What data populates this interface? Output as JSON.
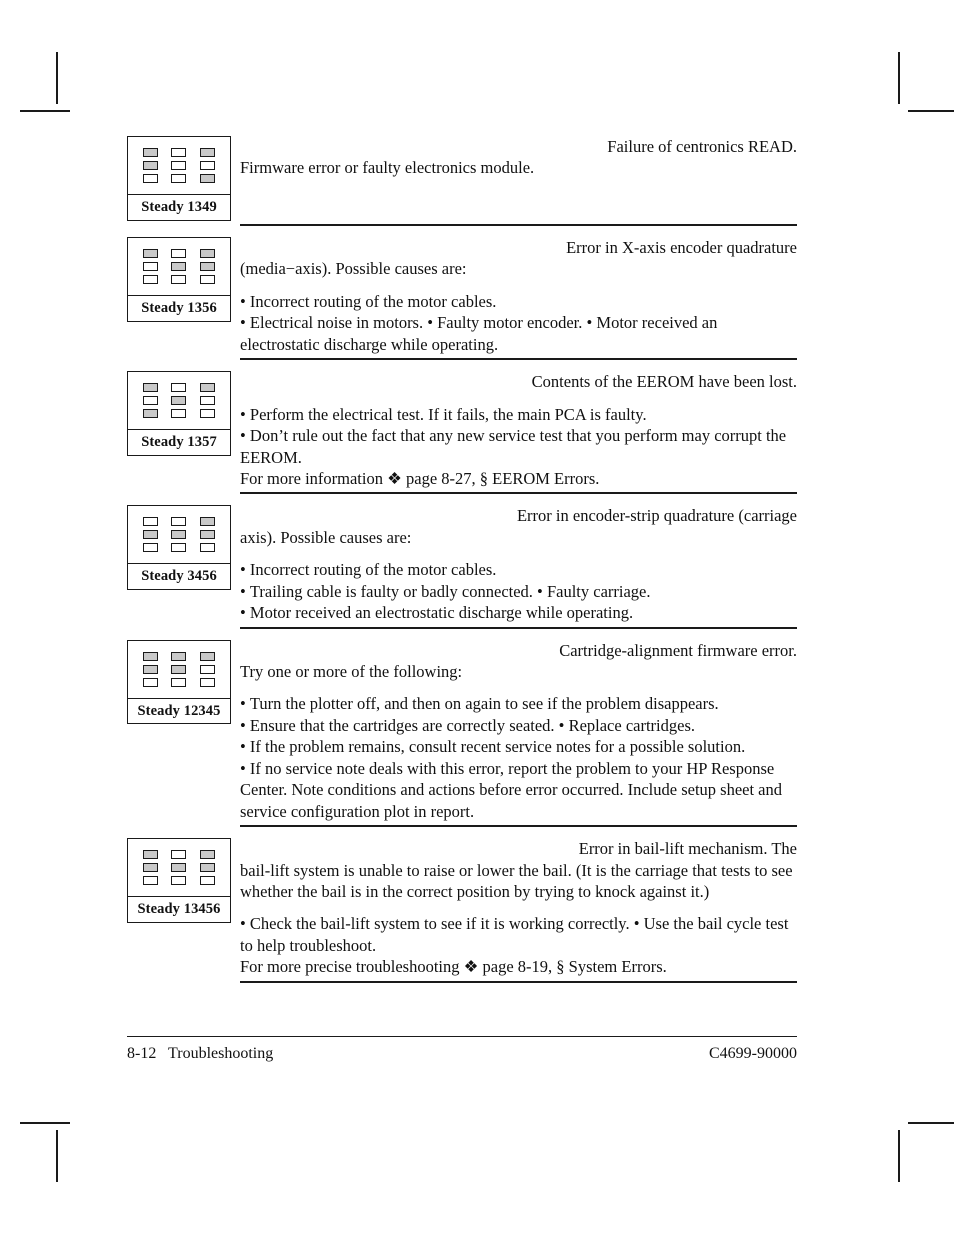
{
  "page": {
    "footer_left": "8-12   Troubleshooting",
    "footer_right": "C4699-90000"
  },
  "entries": [
    {
      "code_label": "Steady 1349",
      "leds": [
        [
          1,
          0,
          1
        ],
        [
          1,
          0,
          0
        ],
        [
          0,
          0,
          1
        ]
      ],
      "title": "Failure of centronics READ.",
      "lead": "Firmware error or faulty electronics module.",
      "lines": []
    },
    {
      "code_label": "Steady 1356",
      "leds": [
        [
          1,
          0,
          1
        ],
        [
          0,
          1,
          1
        ],
        [
          0,
          0,
          0
        ]
      ],
      "title": "Error in X-axis encoder quadrature",
      "lead": "(media−axis). Possible causes are:",
      "lines": [
        "Incorrect routing of the motor cables.",
        "Electrical noise in motors. • Faulty motor encoder. • Motor received an electrostatic discharge while operating."
      ]
    },
    {
      "code_label": "Steady 1357",
      "leds": [
        [
          1,
          0,
          1
        ],
        [
          0,
          1,
          0
        ],
        [
          1,
          0,
          0
        ]
      ],
      "title": "Contents of the EEROM have been lost.",
      "lead": "",
      "lines": [
        "Perform the electrical test. If it fails, the main PCA is faulty.",
        "Don’t rule out the fact that any new service test that you perform may corrupt the EEROM."
      ],
      "footnote": "For more information ❖ page 8-27, § EEROM Errors."
    },
    {
      "code_label": "Steady 3456",
      "leds": [
        [
          0,
          0,
          1
        ],
        [
          1,
          1,
          1
        ],
        [
          0,
          0,
          0
        ]
      ],
      "title": "Error in encoder-strip quadrature (carriage",
      "lead": "axis). Possible causes are:",
      "lines": [
        "Incorrect routing of the motor cables.",
        "Trailing cable is faulty or badly connected. • Faulty carriage.",
        "Motor received an electrostatic discharge while operating."
      ]
    },
    {
      "code_label": "Steady 12345",
      "leds": [
        [
          1,
          1,
          1
        ],
        [
          1,
          1,
          0
        ],
        [
          0,
          0,
          0
        ]
      ],
      "title": "Cartridge-alignment firmware error.",
      "lead": "Try one or more of the following:",
      "lines": [
        "Turn the plotter off, and then on again to see if the problem disappears.",
        "Ensure that the cartridges are correctly seated. • Replace cartridges.",
        "If the problem remains, consult recent service notes for a possible solution.",
        "If no service note deals with this error, report the problem to your HP Response Center.  Note conditions and actions before error occurred.  Include setup sheet and service configuration plot in report."
      ]
    },
    {
      "code_label": "Steady 13456",
      "leds": [
        [
          1,
          0,
          1
        ],
        [
          1,
          1,
          1
        ],
        [
          0,
          0,
          0
        ]
      ],
      "title": "Error in bail-lift mechanism.  The",
      "lead": "bail-lift system is unable to raise or lower the bail. (It is the carriage that tests to see whether the bail is in the correct position by trying to knock against it.)",
      "lines": [
        "Check the bail-lift system to see if it is working correctly. • Use the bail cycle test to help troubleshoot."
      ],
      "footnote": "For more precise troubleshooting ❖ page 8-19, § System Errors."
    }
  ]
}
